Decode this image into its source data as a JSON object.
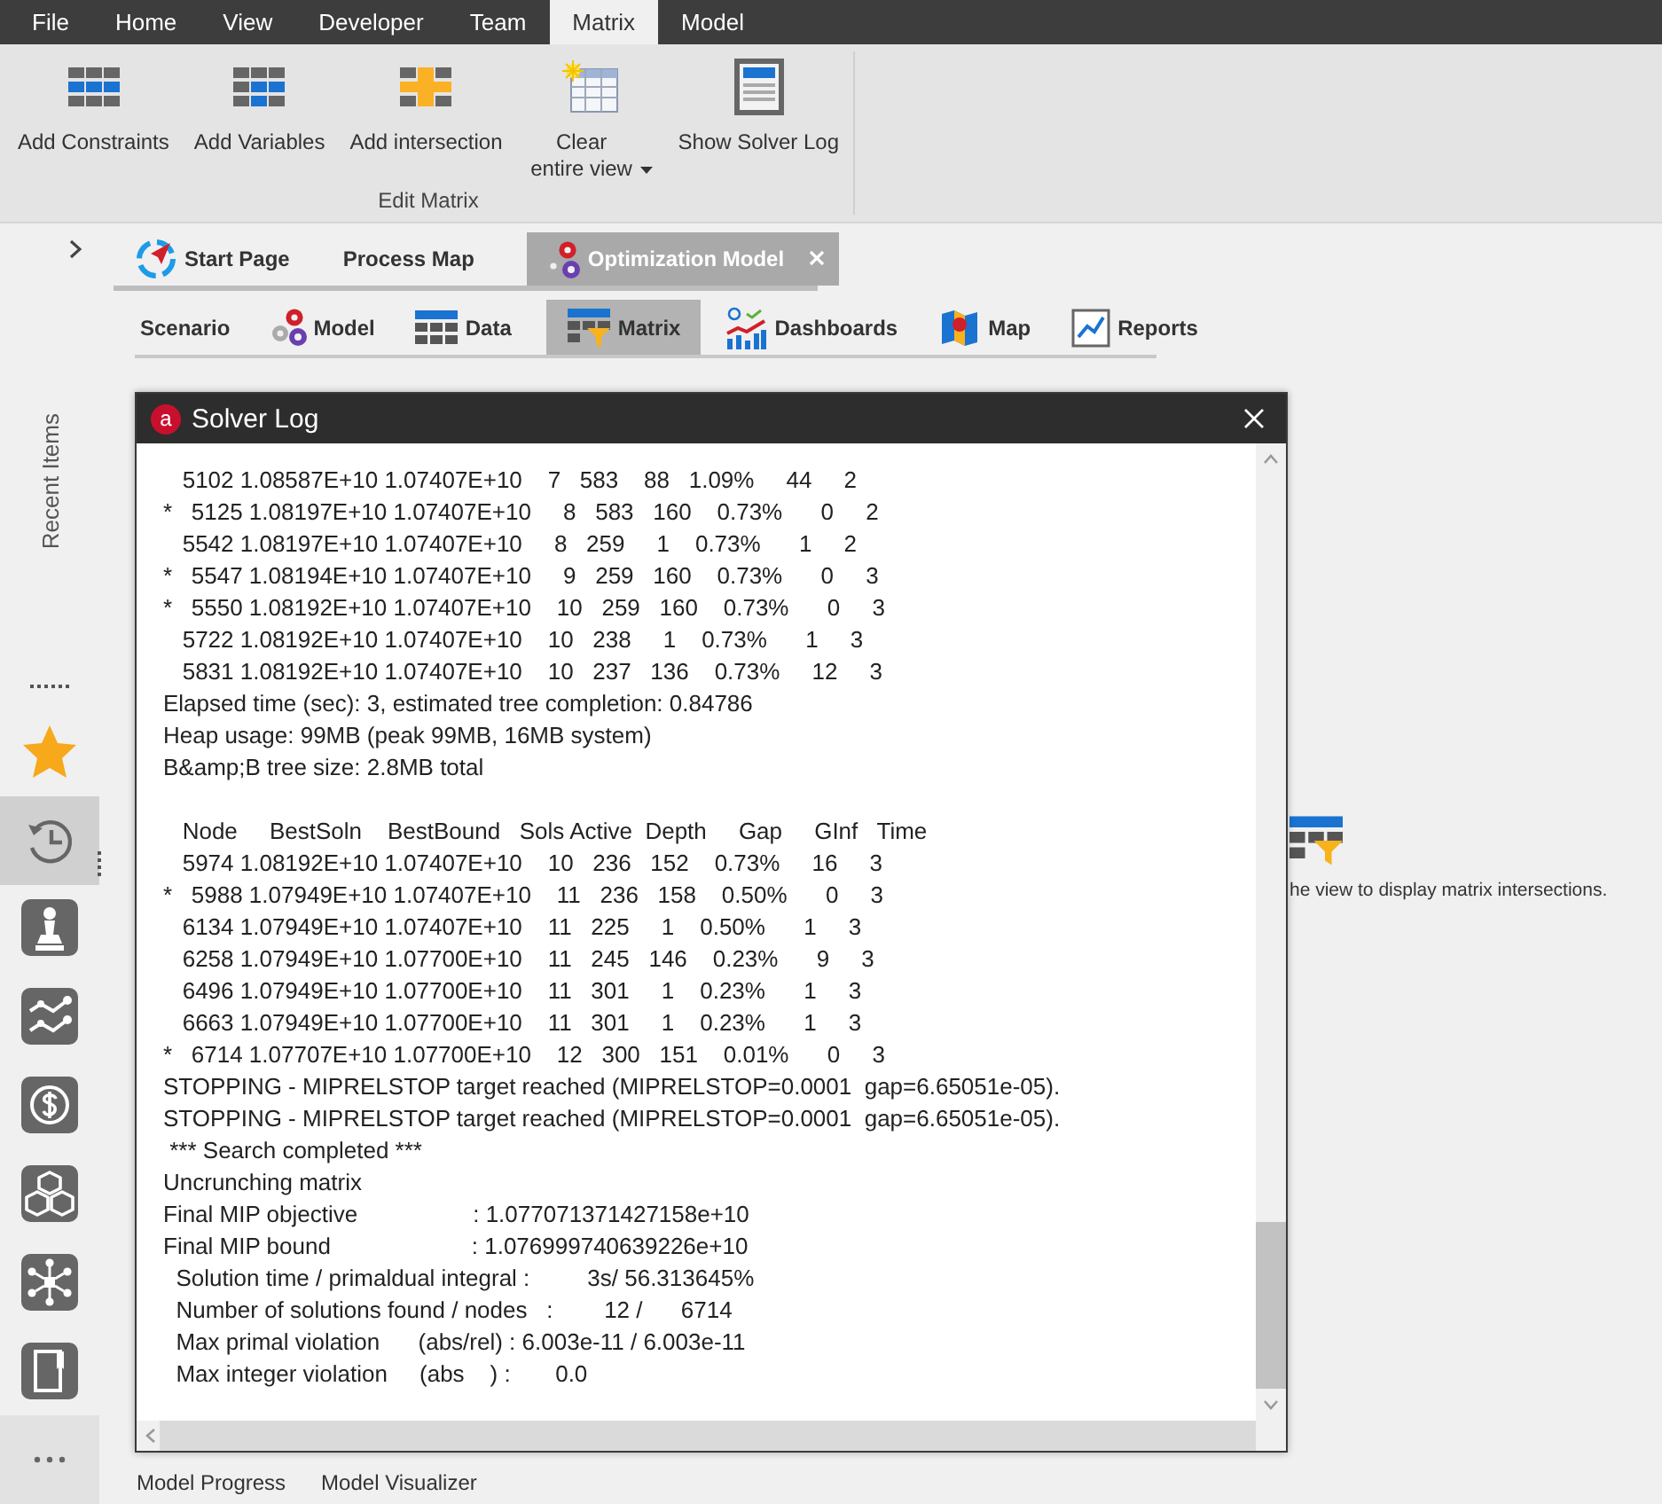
{
  "menu": [
    {
      "label": "File",
      "selected": false
    },
    {
      "label": "Home",
      "selected": false
    },
    {
      "label": "View",
      "selected": false
    },
    {
      "label": "Developer",
      "selected": false
    },
    {
      "label": "Team",
      "selected": false
    },
    {
      "label": "Matrix",
      "selected": true
    },
    {
      "label": "Model",
      "selected": false
    }
  ],
  "ribbon": {
    "buttons": [
      {
        "label": "Add Constraints",
        "kind": "constraints",
        "dropdown": false
      },
      {
        "label": "Add Variables",
        "kind": "variables",
        "dropdown": false
      },
      {
        "label": "Add intersection",
        "kind": "intersection",
        "dropdown": false
      },
      {
        "label": "Clear entire view",
        "kind": "clear",
        "dropdown": true
      },
      {
        "label": "Show Solver Log",
        "kind": "log",
        "dropdown": false
      }
    ],
    "group": "Edit Matrix"
  },
  "sidebar": {
    "recent_label": "Recent Items",
    "items": [
      {
        "kind": "star",
        "selected": false
      },
      {
        "kind": "history",
        "selected": true
      },
      {
        "kind": "chess",
        "selected": false
      },
      {
        "kind": "chart",
        "selected": false
      },
      {
        "kind": "dollar",
        "selected": false
      },
      {
        "kind": "cubes",
        "selected": false
      },
      {
        "kind": "network",
        "selected": false
      },
      {
        "kind": "notebook",
        "selected": false
      }
    ]
  },
  "doc_tabs": [
    {
      "label": "Start Page",
      "kind": "start",
      "selected": false,
      "closable": false
    },
    {
      "label": "Process Map",
      "kind": "none",
      "selected": false,
      "closable": false
    },
    {
      "label": "Optimization Model",
      "kind": "gears",
      "selected": true,
      "closable": true
    }
  ],
  "sub_tabs": [
    {
      "label": "Scenario",
      "kind": "none",
      "selected": false
    },
    {
      "label": "Model",
      "kind": "gears",
      "selected": false
    },
    {
      "label": "Data",
      "kind": "table",
      "selected": false
    },
    {
      "label": "Matrix",
      "kind": "matrix",
      "selected": true
    },
    {
      "label": "Dashboards",
      "kind": "dashboard",
      "selected": false
    },
    {
      "label": "Map",
      "kind": "map",
      "selected": false
    },
    {
      "label": "Reports",
      "kind": "reports",
      "selected": false
    }
  ],
  "hint": "he view to display matrix intersections.",
  "dialog": {
    "logo": "a",
    "title": "Solver Log",
    "lines": [
      {
        "kind": "text",
        "text": "   5102 1.08587E+10 1.07407E+10    7   583    88   1.09%     44     2"
      },
      {
        "kind": "text",
        "text": "*   5125 1.08197E+10 1.07407E+10     8   583   160    0.73%      0     2"
      },
      {
        "kind": "text",
        "text": "   5542 1.08197E+10 1.07407E+10     8   259     1    0.73%      1     2"
      },
      {
        "kind": "text",
        "text": "*   5547 1.08194E+10 1.07407E+10     9   259   160    0.73%      0     3"
      },
      {
        "kind": "text",
        "text": "*   5550 1.08192E+10 1.07407E+10    10   259   160    0.73%      0     3"
      },
      {
        "kind": "text",
        "text": "   5722 1.08192E+10 1.07407E+10    10   238     1    0.73%      1     3"
      },
      {
        "kind": "text",
        "text": "   5831 1.08192E+10 1.07407E+10    10   237   136    0.73%     12     3"
      },
      {
        "kind": "text",
        "text": "Elapsed time (sec): 3, estimated tree completion: 0.84786"
      },
      {
        "kind": "text",
        "text": "Heap usage: 99MB (peak 99MB, 16MB system)"
      },
      {
        "kind": "text",
        "text": "B&amp;B tree size: 2.8MB total"
      },
      {
        "kind": "header",
        "text": "   Node     BestSoln    BestBound   Sols Active  Depth     Gap     GInf   Time"
      },
      {
        "kind": "text",
        "text": "   5974 1.08192E+10 1.07407E+10    10   236   152    0.73%     16     3"
      },
      {
        "kind": "text",
        "text": "*   5988 1.07949E+10 1.07407E+10    11   236   158    0.50%      0     3"
      },
      {
        "kind": "text",
        "text": "   6134 1.07949E+10 1.07407E+10    11   225     1    0.50%      1     3"
      },
      {
        "kind": "text",
        "text": "   6258 1.07949E+10 1.07700E+10    11   245   146    0.23%      9     3"
      },
      {
        "kind": "text",
        "text": "   6496 1.07949E+10 1.07700E+10    11   301     1    0.23%      1     3"
      },
      {
        "kind": "text",
        "text": "   6663 1.07949E+10 1.07700E+10    11   301     1    0.23%      1     3"
      },
      {
        "kind": "text",
        "text": "*   6714 1.07707E+10 1.07700E+10    12   300   151    0.01%      0     3"
      },
      {
        "kind": "text",
        "text": "STOPPING - MIPRELSTOP target reached (MIPRELSTOP=0.0001  gap=6.65051e-05)."
      },
      {
        "kind": "text",
        "text": "STOPPING - MIPRELSTOP target reached (MIPRELSTOP=0.0001  gap=6.65051e-05)."
      },
      {
        "kind": "text",
        "text": " *** Search completed ***"
      },
      {
        "kind": "text",
        "text": "Uncrunching matrix"
      },
      {
        "kind": "text",
        "text": "Final MIP objective                  : 1.077071371427158e+10"
      },
      {
        "kind": "text",
        "text": "Final MIP bound                      : 1.076999740639226e+10"
      },
      {
        "kind": "text",
        "text": "  Solution time / primaldual integral :         3s/ 56.313645%"
      },
      {
        "kind": "text",
        "text": "  Number of solutions found / nodes   :        12 /      6714"
      },
      {
        "kind": "text",
        "text": "  Max primal violation      (abs/rel) : 6.003e-11 / 6.003e-11"
      },
      {
        "kind": "text",
        "text": "  Max integer violation     (abs    ) :       0.0"
      }
    ]
  },
  "bottom_tabs": [
    "Model Progress",
    "Model Visualizer"
  ]
}
